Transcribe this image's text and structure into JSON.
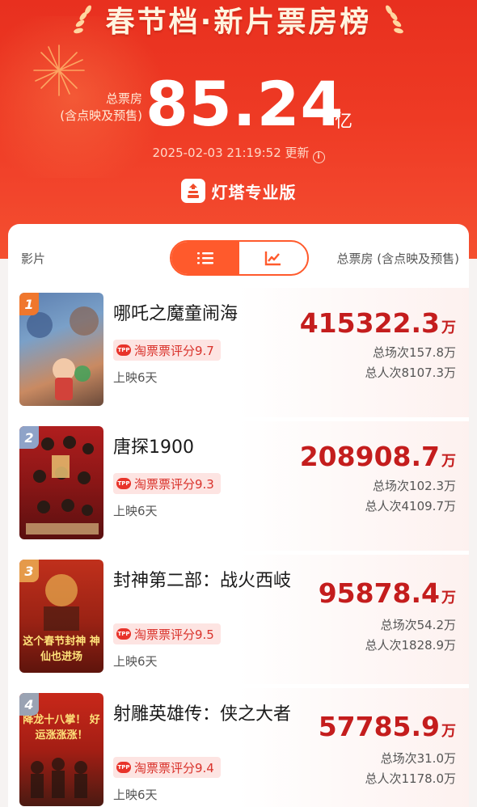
{
  "header": {
    "title": "春节档·新片票房榜",
    "total_label_1": "总票房",
    "total_label_2": "(含点映及预售)",
    "total_value": "85.24",
    "total_unit": "亿",
    "updated": "2025-02-03 21:19:52 更新",
    "brand": "灯塔专业版",
    "colors": {
      "header_red": "#ee3a24",
      "accent_orange": "#ff5a2c",
      "value_red": "#c41d1d"
    }
  },
  "table": {
    "col_left": "影片",
    "col_right": "总票房 (含点映及预售)",
    "toggle": [
      {
        "icon": "list-icon",
        "active": true
      },
      {
        "icon": "chart-icon",
        "active": false
      }
    ]
  },
  "movies": [
    {
      "rank": "1",
      "name": "哪吒之魔童闹海",
      "rating": "淘票票评分9.7",
      "days": "上映6天",
      "box_value": "415322.3",
      "box_unit": "万",
      "shows": "总场次157.8万",
      "admissions": "总人次8107.3万",
      "rank_color": "#f0772d"
    },
    {
      "rank": "2",
      "name": "唐探1900",
      "rating": "淘票票评分9.3",
      "days": "上映6天",
      "box_value": "208908.7",
      "box_unit": "万",
      "shows": "总场次102.3万",
      "admissions": "总人次4109.7万",
      "rank_color": "#8fa3c8"
    },
    {
      "rank": "3",
      "name": "封神第二部：战火西岐",
      "rating": "淘票票评分9.5",
      "days": "上映6天",
      "box_value": "95878.4",
      "box_unit": "万",
      "shows": "总场次54.2万",
      "admissions": "总人次1828.9万",
      "rank_color": "#e59a4a"
    },
    {
      "rank": "4",
      "name": "射雕英雄传：侠之大者",
      "rating": "淘票票评分9.4",
      "days": "上映6天",
      "box_value": "57785.9",
      "box_unit": "万",
      "shows": "总场次31.0万",
      "admissions": "总人次1178.0万",
      "rank_color": "#9aa3b3"
    }
  ],
  "posters": [
    {
      "text": ""
    },
    {
      "text": ""
    },
    {
      "text": "这个春节封神 神仙也进场"
    },
    {
      "text": "降龙十八掌！ 好运涨涨涨！"
    }
  ]
}
